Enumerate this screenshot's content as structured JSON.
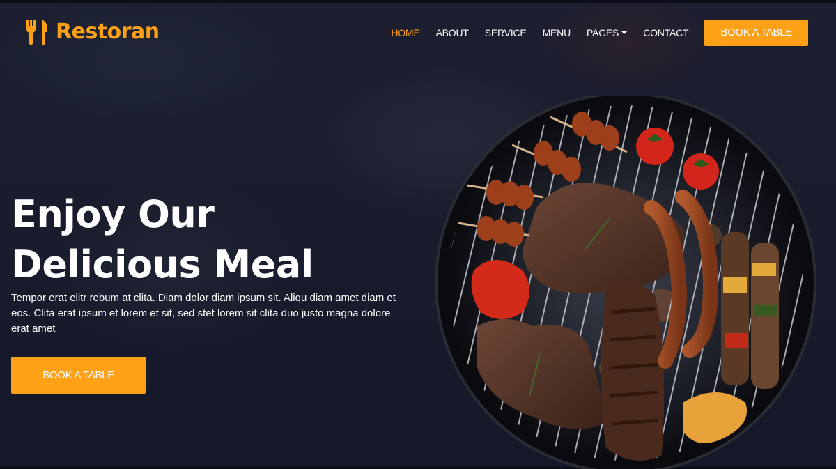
{
  "brand": {
    "name": "Restoran",
    "icon": "utensils-icon"
  },
  "nav": {
    "items": [
      {
        "label": "Home",
        "active": true
      },
      {
        "label": "About",
        "active": false
      },
      {
        "label": "Service",
        "active": false
      },
      {
        "label": "Menu",
        "active": false
      },
      {
        "label": "Pages",
        "active": false,
        "dropdown": true
      },
      {
        "label": "Contact",
        "active": false
      }
    ],
    "cta_label": "Book A Table"
  },
  "hero": {
    "title_line1": "Enjoy Our",
    "title_line2": "Delicious Meal",
    "text": "Tempor erat elitr rebum at clita. Diam dolor diam ipsum sit. Aliqu diam amet diam et eos. Clita erat ipsum et lorem et sit, sed stet lorem sit clita duo justo magna dolore erat amet",
    "button_label": "Book A Table",
    "image_alt": "Barbecue grill with steaks, sausages, skewers, tomatoes and peppers"
  },
  "colors": {
    "accent": "#FEA116",
    "background": "#161a2b",
    "text": "#ffffff"
  }
}
